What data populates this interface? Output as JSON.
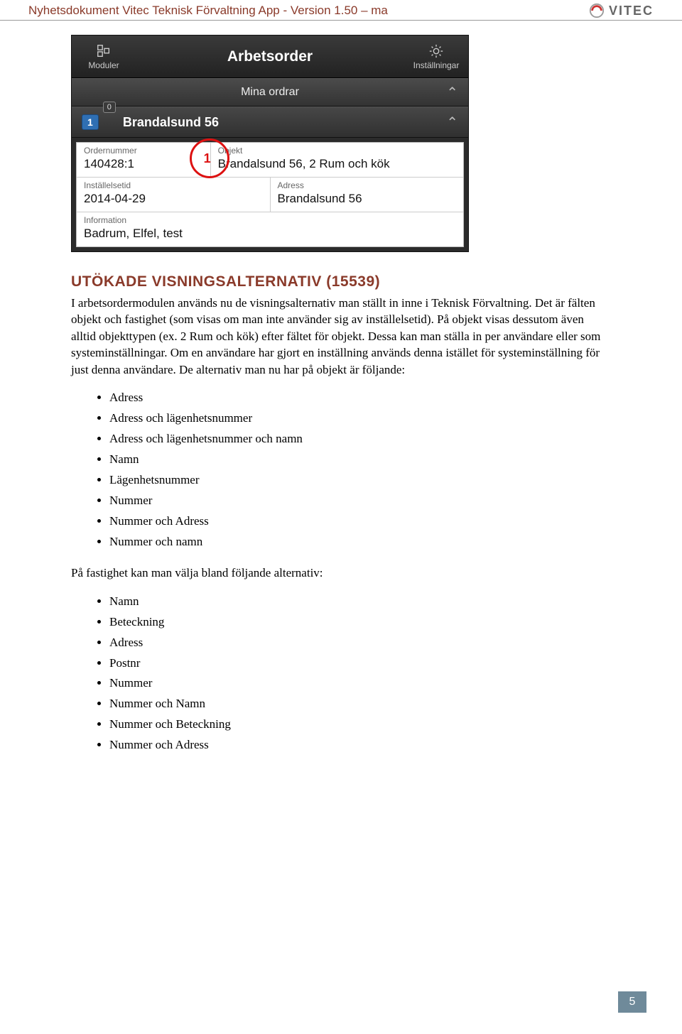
{
  "header": {
    "title": "Nyhetsdokument Vitec Teknisk Förvaltning App - Version 1.50 – ma",
    "logo_text": "VITEC"
  },
  "mobile": {
    "left_label": "Moduler",
    "title": "Arbetsorder",
    "right_label": "Inställningar",
    "section": "Mina ordrar",
    "badge_main": "1",
    "badge_sub": "0",
    "item_title": "Brandalsund 56",
    "annotation_num": "1",
    "cells": {
      "ordernummer_label": "Ordernummer",
      "ordernummer_value": "140428:1",
      "objekt_label": "Objekt",
      "objekt_value": "Brandalsund 56, 2 Rum och kök",
      "installelsetid_label": "Inställelsetid",
      "installelsetid_value": "2014-04-29",
      "adress_label": "Adress",
      "adress_value": "Brandalsund 56",
      "information_label": "Information",
      "information_value": "Badrum, Elfel, test"
    }
  },
  "doc": {
    "heading": "UTÖKADE VISNINGSALTERNATIV (15539)",
    "para": "I arbetsordermodulen används nu de visningsalternativ man ställt in inne i Teknisk Förvaltning. Det är fälten objekt och fastighet (som visas om man inte använder sig av inställelsetid). På objekt visas dessutom även alltid objekttypen (ex. 2 Rum och kök) efter fältet för objekt. Dessa kan man ställa in per användare eller som systeminställningar. Om en användare har gjort en inställning används denna istället för systeminställning för just denna användare. De alternativ man nu har på objekt är följande:",
    "list1": [
      "Adress",
      "Adress och lägenhetsnummer",
      "Adress och lägenhetsnummer och namn",
      "Namn",
      "Lägenhetsnummer",
      "Nummer",
      "Nummer och Adress",
      "Nummer och namn"
    ],
    "para2": "På fastighet kan man välja bland följande alternativ:",
    "list2": [
      "Namn",
      "Beteckning",
      "Adress",
      "Postnr",
      "Nummer",
      "Nummer och Namn",
      "Nummer och Beteckning",
      "Nummer och Adress"
    ]
  },
  "page_number": "5"
}
